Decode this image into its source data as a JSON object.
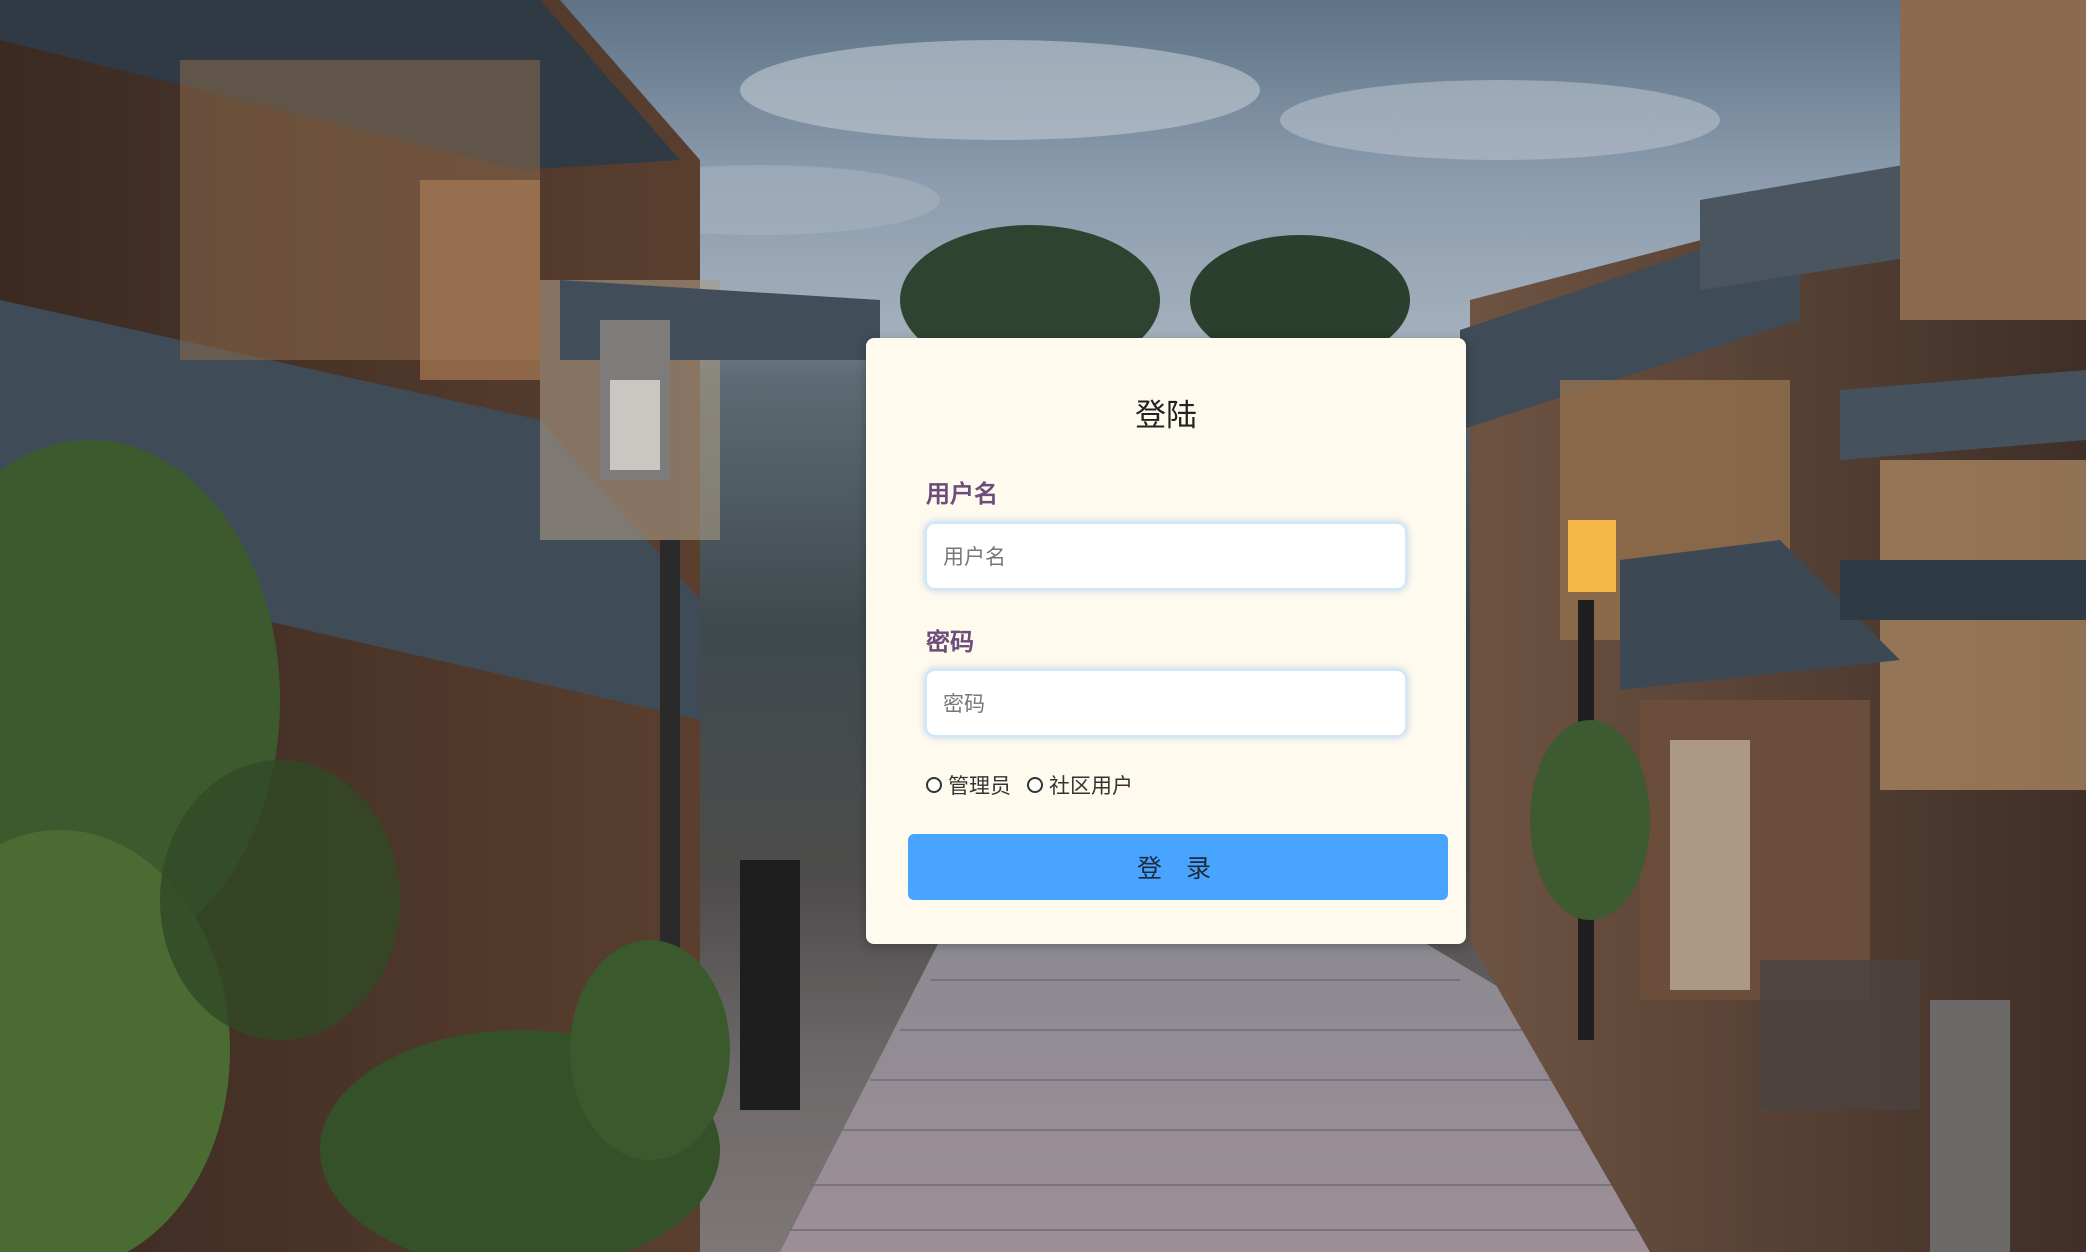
{
  "login": {
    "title": "登陆",
    "username_label": "用户名",
    "username_placeholder": "用户名",
    "password_label": "密码",
    "password_placeholder": "密码",
    "roles": [
      "管理员",
      "社区用户"
    ],
    "submit_label": "登 录"
  },
  "colors": {
    "card_background": "#fffaee",
    "label_color": "#6b4c7a",
    "button_color": "#49a4ff"
  }
}
